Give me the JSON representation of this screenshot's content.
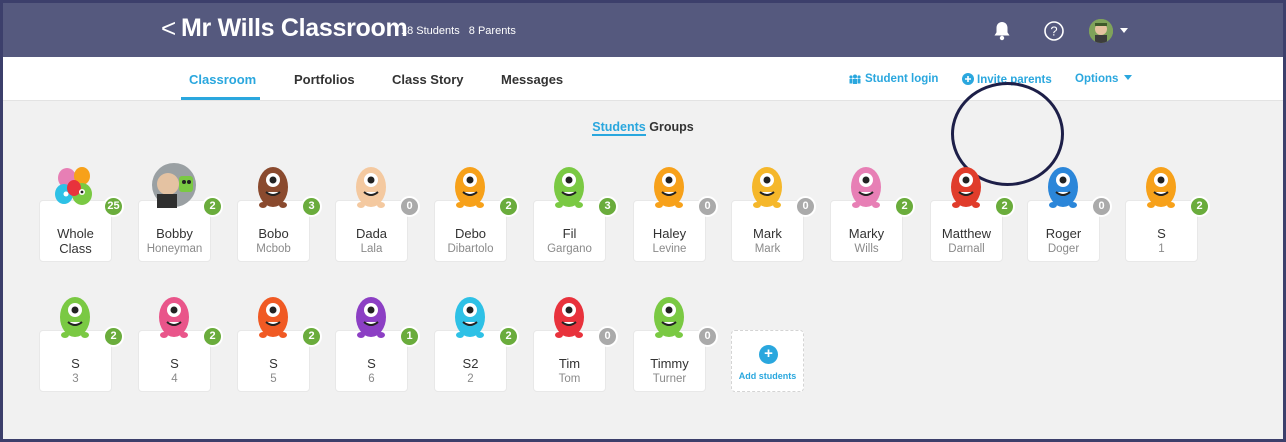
{
  "header": {
    "back_glyph": "<",
    "title": "Mr Wills Classroom",
    "students_count": "18 Students",
    "parents_count": "8 Parents"
  },
  "nav": {
    "tabs": [
      {
        "label": "Classroom",
        "active": true
      },
      {
        "label": "Portfolios"
      },
      {
        "label": "Class Story"
      },
      {
        "label": "Messages"
      }
    ],
    "student_login": "Student login",
    "invite_parents": "Invite parents",
    "options": "Options"
  },
  "toggle": {
    "students": "Students",
    "groups": "Groups"
  },
  "students": [
    {
      "first": "Whole",
      "last": "Class",
      "points": "25",
      "type": "group"
    },
    {
      "first": "Bobby",
      "last": "Honeyman",
      "points": "2",
      "type": "photo"
    },
    {
      "first": "Bobo",
      "last": "Mcbob",
      "points": "3",
      "color": "#8a4a2e"
    },
    {
      "first": "Dada",
      "last": "Lala",
      "points": "0",
      "color": "#f4c9a0"
    },
    {
      "first": "Debo",
      "last": "Dibartolo",
      "points": "2",
      "color": "#f7a11a"
    },
    {
      "first": "Fil",
      "last": "Gargano",
      "points": "3",
      "color": "#7ac943"
    },
    {
      "first": "Haley",
      "last": "Levine",
      "points": "0",
      "color": "#f7a11a"
    },
    {
      "first": "Mark",
      "last": "Mark",
      "points": "0",
      "color": "#f5b72a"
    },
    {
      "first": "Marky",
      "last": "Wills",
      "points": "2",
      "color": "#e77fb5"
    },
    {
      "first": "Matthew",
      "last": "Darnall",
      "points": "2",
      "color": "#e03c2b"
    },
    {
      "first": "Roger",
      "last": "Doger",
      "points": "0",
      "color": "#2b86d9"
    },
    {
      "first": "S",
      "last": "1",
      "points": "2",
      "color": "#f7a11a"
    },
    {
      "first": "S",
      "last": "3",
      "points": "2",
      "color": "#7ac943"
    },
    {
      "first": "S",
      "last": "4",
      "points": "2",
      "color": "#e9558a"
    },
    {
      "first": "S",
      "last": "5",
      "points": "2",
      "color": "#f05a24"
    },
    {
      "first": "S",
      "last": "6",
      "points": "1",
      "color": "#8c3fc4"
    },
    {
      "first": "S2",
      "last": "2",
      "points": "2",
      "color": "#2ec1e6"
    },
    {
      "first": "Tim",
      "last": "Tom",
      "points": "0",
      "color": "#e8323c"
    },
    {
      "first": "Timmy",
      "last": "Turner",
      "points": "0",
      "color": "#7ac943"
    }
  ],
  "add_students": "Add students",
  "colors": {
    "topbar": "#55597e",
    "accent": "#2aa7de",
    "points_green": "#6aac3c",
    "points_gray": "#aaaaaa",
    "annotation_circle": "#1d1f48"
  }
}
